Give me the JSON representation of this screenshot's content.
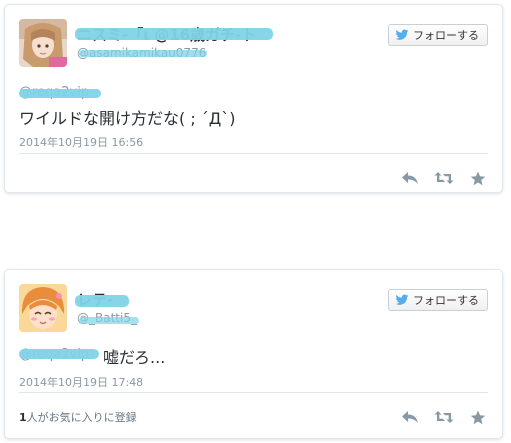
{
  "tweets": [
    {
      "user_name": "ニスミ-「ι @16歳ガチ-ト",
      "user_handle": "@asamikamikau0776",
      "follow_label": "フォローする",
      "mention": "@reqa2vip",
      "text": "ワイルドな開け方だな( ; ´Д`)",
      "timestamp": "2014年10月19日 16:56",
      "actions": [
        "reply-icon",
        "retweet-icon",
        "favorite-icon"
      ]
    },
    {
      "user_name": "レテ-",
      "user_handle": "@_Batti5_",
      "follow_label": "フォローする",
      "mention": "@reqa2vip",
      "text": "嘘だろ...",
      "timestamp": "2014年10月19日 17:48",
      "favorite_count": "1",
      "favorite_suffix": "人がお気に入りに登録",
      "actions": [
        "reply-icon",
        "retweet-icon",
        "favorite-icon"
      ]
    }
  ],
  "colors": {
    "border": "#e1e8ed",
    "text": "#292f33",
    "muted": "#8899a6",
    "icon": "#8899a6",
    "twitter_blue": "#55acee",
    "redaction": "#7fd3e8"
  }
}
